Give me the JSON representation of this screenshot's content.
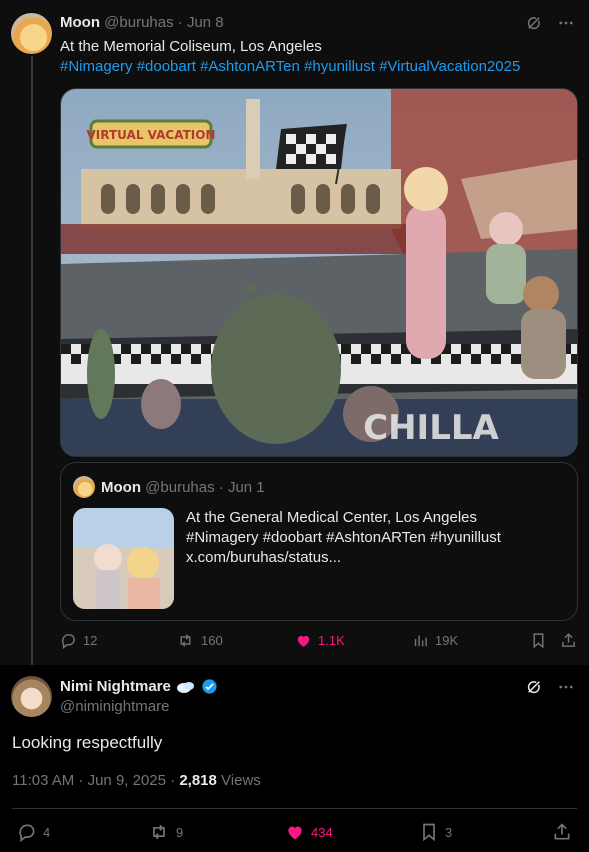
{
  "parent_tweet": {
    "name": "Moon",
    "handle": "@buruhas",
    "date": "Jun 8",
    "text": "At the Memorial Coliseum, Los Angeles",
    "hashtags": "#Nimagery #doobart #AshtonARTen #hyunillust #VirtualVacation2025",
    "image_banner": "VIRTUAL VACATION",
    "track_text": "CHILLA",
    "quote": {
      "name": "Moon",
      "handle": "@buruhas",
      "date": "Jun 1",
      "line1": "At the General Medical Center, Los Angeles",
      "line2": "#Nimagery #doobart #AshtonARTen #hyunillust",
      "line3": "x.com/buruhas/status..."
    },
    "stats": {
      "replies": "12",
      "reposts": "160",
      "likes": "1.1K",
      "views": "19K"
    }
  },
  "reply_tweet": {
    "name": "Nimi Nightmare",
    "handle": "@niminightmare",
    "text": "Looking respectfully",
    "time": "11:03 AM · Jun 9, 2025 · ",
    "views_count": "2,818",
    "views_label": " Views",
    "stats": {
      "replies": "4",
      "reposts": "9",
      "likes": "434",
      "bookmarks": "3"
    }
  },
  "colors": {
    "link": "#1d9bf0",
    "like": "#f91880",
    "verified": "#1d9bf0",
    "muted": "#71767b"
  },
  "icons": [
    "grok-icon",
    "more-icon",
    "reply-icon",
    "repost-icon",
    "heart-icon",
    "views-icon",
    "bookmark-icon",
    "share-icon",
    "verified-icon",
    "cloud-emoji-icon"
  ]
}
